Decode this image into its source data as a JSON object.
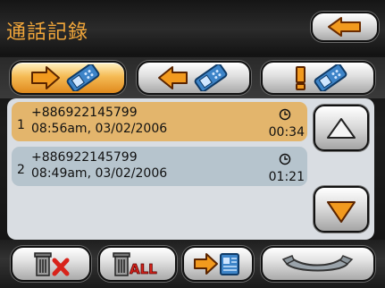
{
  "header": {
    "title": "通話記錄",
    "back_icon": "back-arrow-icon"
  },
  "tabs": [
    {
      "name": "dialed-calls",
      "icon": "outgoing-call-icon",
      "active": true
    },
    {
      "name": "received-calls",
      "icon": "incoming-call-icon",
      "active": false
    },
    {
      "name": "missed-calls",
      "icon": "missed-call-icon",
      "active": false
    }
  ],
  "calls": [
    {
      "index": "1",
      "number": "+886922145799",
      "datetime": "08:56am, 03/02/2006",
      "duration": "00:34",
      "selected": true
    },
    {
      "index": "2",
      "number": "+886922145799",
      "datetime": "08:49am, 03/02/2006",
      "duration": "01:21",
      "selected": false
    }
  ],
  "toolbar": {
    "delete_icon": "delete-one-icon",
    "delete_all_label": "ALL",
    "save_icon": "save-to-contacts-icon",
    "call_icon": "call-handset-icon"
  },
  "colors": {
    "title": "#f1a63a",
    "selected_row": "#e3b56c",
    "normal_row": "#b6c4cd",
    "active_tab": "#f5bb55",
    "accent_orange": "#f29a1e",
    "delete_red": "#d8231b"
  }
}
